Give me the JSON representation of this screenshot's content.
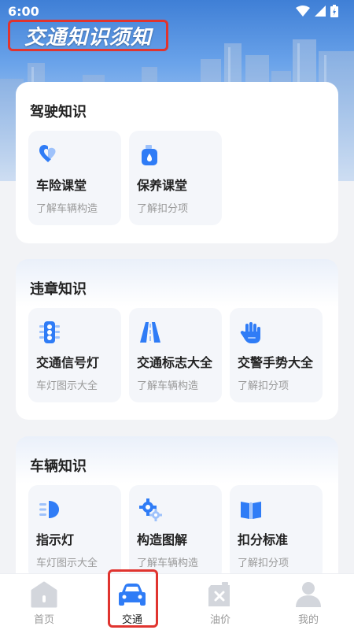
{
  "status": {
    "time": "6:00"
  },
  "header": {
    "title": "交通知识须知"
  },
  "sections": [
    {
      "title": "驾驶知识",
      "items": [
        {
          "title": "车险课堂",
          "subtitle": "了解车辆构造",
          "icon": "shield-heart-icon"
        },
        {
          "title": "保养课堂",
          "subtitle": "了解扣分项",
          "icon": "oil-bottle-icon"
        }
      ]
    },
    {
      "title": "违章知识",
      "items": [
        {
          "title": "交通信号灯",
          "subtitle": "车灯图示大全",
          "icon": "traffic-light-icon"
        },
        {
          "title": "交通标志大全",
          "subtitle": "了解车辆构造",
          "icon": "road-icon"
        },
        {
          "title": "交警手势大全",
          "subtitle": "了解扣分项",
          "icon": "hand-icon"
        }
      ]
    },
    {
      "title": "车辆知识",
      "items": [
        {
          "title": "指示灯",
          "subtitle": "车灯图示大全",
          "icon": "headlight-icon"
        },
        {
          "title": "构造图解",
          "subtitle": "了解车辆构造",
          "icon": "gears-icon"
        },
        {
          "title": "扣分标准",
          "subtitle": "了解扣分项",
          "icon": "book-icon"
        }
      ]
    }
  ],
  "tabbar": {
    "active": "交通",
    "tabs": [
      {
        "label": "首页",
        "icon": "home-icon"
      },
      {
        "label": "交通",
        "icon": "car-icon"
      },
      {
        "label": "油价",
        "icon": "fuel-can-icon"
      },
      {
        "label": "我的",
        "icon": "user-icon"
      }
    ]
  },
  "colors": {
    "accent": "#2f7cf6",
    "highlight": "#e0342f",
    "inactive_tab": "#cfd2d8"
  }
}
